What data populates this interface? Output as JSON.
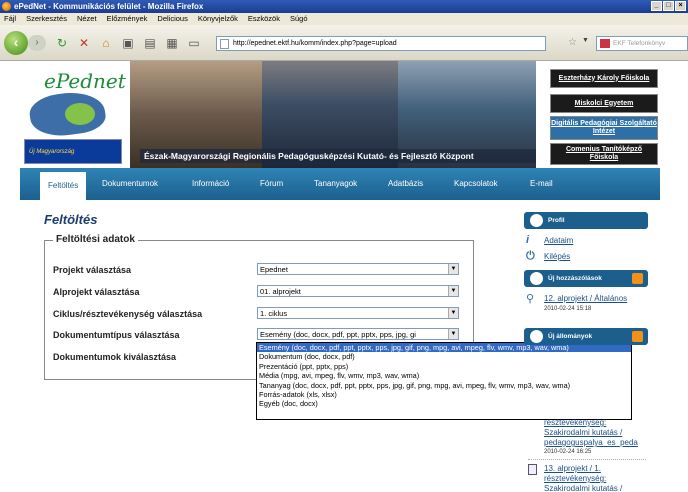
{
  "window": {
    "title": "ePedNet - Kommunikációs felület - Mozilla Firefox"
  },
  "menubar": [
    "Fájl",
    "Szerkesztés",
    "Nézet",
    "Előzmények",
    "Delicious",
    "Könyvjelzők",
    "Eszközök",
    "Súgó"
  ],
  "url": "http://epednet.ektf.hu/komm/index.php?page=upload",
  "search_placeholder": "EKF Telefonkönyv",
  "banner": {
    "logo": "ePednet",
    "um_logo": "Új Magyarország",
    "caption": "Észak-Magyarországi Regionális Pedagógusképzési Kutató- és Fejlesztő Központ",
    "institutions": [
      "Eszterházy Károly Főiskola",
      "Miskolci Egyetem",
      "Digitális Pedagógiai Szolgáltató Intézet",
      "Comenius Tanítóképző Főiskola"
    ]
  },
  "nav": {
    "items": [
      "Feltöltés",
      "Dokumentumok",
      "Információ",
      "Fórum",
      "Tananyagok",
      "Adatbázis",
      "Kapcsolatok",
      "E-mail"
    ],
    "active": "Feltöltés"
  },
  "page": {
    "title": "Feltöltés",
    "legend": "Feltöltési adatok",
    "fields": [
      {
        "label": "Projekt választása",
        "value": "Epednet"
      },
      {
        "label": "Alprojekt választása",
        "value": "01. alprojekt"
      },
      {
        "label": "Ciklus/résztevékenység választása",
        "value": "1. ciklus"
      },
      {
        "label": "Dokumentumtípus választása",
        "value": "Esemény (doc, docx, pdf, ppt, pptx, pps, jpg, gi"
      },
      {
        "label": "Dokumentumok kiválasztása",
        "value": ""
      }
    ],
    "dropdown_options": [
      "Esemény (doc, docx, pdf, ppt, pptx, pps, jpg, gif, png, mpg, avi, mpeg, flv, wmv, mp3, wav, wma)",
      "Dokumentum (doc, docx, pdf)",
      "Prezentáció (ppt, pptx, pps)",
      "Média (mpg, avi, mpeg, flv, wmv, mp3, wav, wma)",
      "Tananyag (doc, docx, pdf, ppt, pptx, pps, jpg, gif, png, mpg, avi, mpeg, flv, wmv, mp3, wav, wma)",
      "Forrás-adatok (xls, xlsx)",
      "Egyéb (doc, docx)"
    ]
  },
  "sidebar": {
    "profile_head": "Profil",
    "profile_links": [
      "Adataim",
      "Kilépés"
    ],
    "comments_head": "Új hozzászólások",
    "comment_link": "12. alprojekt / Általános",
    "comment_date": "2010-02-24 15:18",
    "docs_head": "Új állományok",
    "doc1_link_lines": [
      "résztevékenység:",
      "Szakirodalmi kutatás /",
      "pedagoguspalya_es_peda"
    ],
    "doc1_date": "2010-02-24 16:25",
    "doc2_link_lines": [
      "13. alprojekt / 1.",
      "résztevékenység:",
      "Szakirodalmi kutatás /"
    ]
  }
}
